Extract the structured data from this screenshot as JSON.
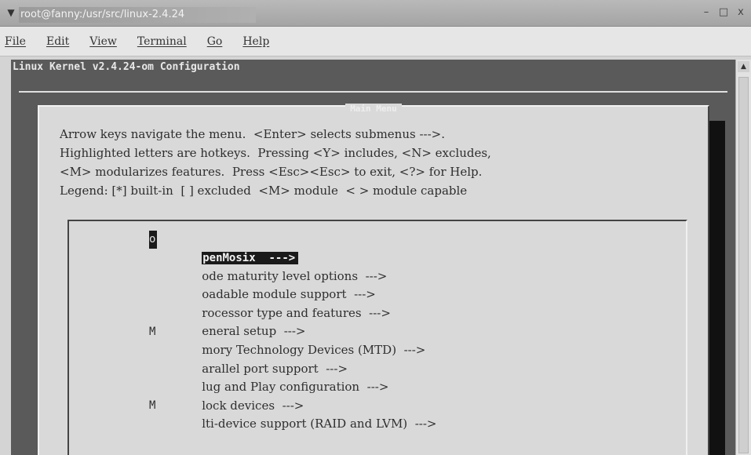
{
  "window": {
    "title": "root@fanny:/usr/src/linux-2.4.24",
    "menu_icon": "down-arrow",
    "buttons": {
      "minimize": "–",
      "maximize": "□",
      "close": "x"
    }
  },
  "menubar": {
    "items": [
      "File",
      "Edit",
      "View",
      "Terminal",
      "Go",
      "Help"
    ]
  },
  "terminal": {
    "header": "Linux Kernel v2.4.24-om Configuration"
  },
  "dialog": {
    "title": "Main Menu",
    "help_lines": [
      "Arrow keys navigate the menu.  <Enter> selects submenus --->.",
      "Highlighted letters are hotkeys.  Pressing <Y> includes, <N> excludes,",
      "<M> modularizes features.  Press <Esc><Esc> to exit, <?> for Help.",
      "Legend: [*] built-in  [ ] excluded  <M> module  < > module capable"
    ],
    "menu_items": [
      {
        "hotkey": "o",
        "label": "penMosix  --->",
        "selected": true
      },
      {
        "hotkey": "",
        "label": "ode maturity level options  --->",
        "selected": false
      },
      {
        "hotkey": "",
        "label": "oadable module support  --->",
        "selected": false
      },
      {
        "hotkey": "",
        "label": "rocessor type and features  --->",
        "selected": false
      },
      {
        "hotkey": "",
        "label": "eneral setup  --->",
        "selected": false
      },
      {
        "hotkey": "M",
        "label": "mory Technology Devices (MTD)  --->",
        "selected": false
      },
      {
        "hotkey": "",
        "label": "arallel port support  --->",
        "selected": false
      },
      {
        "hotkey": "",
        "label": "lug and Play configuration  --->",
        "selected": false
      },
      {
        "hotkey": "",
        "label": "lock devices  --->",
        "selected": false
      },
      {
        "hotkey": "M",
        "label": "lti-device support (RAID and LVM)  --->",
        "selected": false
      }
    ]
  },
  "scrollbar": {
    "up_arrow": "▲"
  }
}
